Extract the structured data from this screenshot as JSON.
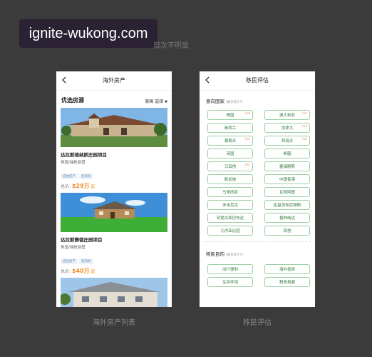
{
  "watermark": "ignite-wukong.com",
  "heading_text": "层次不明显",
  "left_screen": {
    "nav_title": "海外房产",
    "section_title": "优选房源",
    "filter_label": "美国 选择",
    "caret": "▼",
    "listings": [
      {
        "title": "达拉斯维纳斯庄园项目",
        "sub": "美国/独栋别墅",
        "tags": [
          "自住房产",
          "投资房"
        ],
        "price_label": "总价:",
        "price": "$29万",
        "price_unit": "起"
      },
      {
        "title": "达拉斯赛德庄园项目",
        "sub": "美国/独栋别墅",
        "tags": [
          "自住房产",
          "投资房"
        ],
        "price_label": "总价:",
        "price": "$40万",
        "price_unit": "起"
      }
    ],
    "caption": "海外房产列表"
  },
  "right_screen": {
    "nav_title": "移民评估",
    "section1_title": "意向国家",
    "section1_note": "(最多选3个)",
    "hot_label": "Hot",
    "countries": [
      {
        "name": "美国",
        "hot": true
      },
      {
        "name": "澳大利亚",
        "hot": true
      },
      {
        "name": "新西兰",
        "hot": false
      },
      {
        "name": "加拿大",
        "hot": true
      },
      {
        "name": "葡萄牙",
        "hot": true
      },
      {
        "name": "西班牙",
        "hot": true
      },
      {
        "name": "英国",
        "hot": false
      },
      {
        "name": "希腊",
        "hot": false
      },
      {
        "name": "马耳他",
        "hot": true
      },
      {
        "name": "塞浦路斯",
        "hot": false
      },
      {
        "name": "新加坡",
        "hot": false
      },
      {
        "name": "中国香港",
        "hot": false
      },
      {
        "name": "马来西亚",
        "hot": false
      },
      {
        "name": "瓦努阿图",
        "hot": false
      },
      {
        "name": "多米尼克",
        "hot": false
      },
      {
        "name": "圣基茨和尼维斯",
        "hot": false
      },
      {
        "name": "安提瓜和巴布达",
        "hot": false
      },
      {
        "name": "格林纳达",
        "hot": false
      },
      {
        "name": "几内亚比绍",
        "hot": false
      },
      {
        "name": "其他",
        "hot": false
      }
    ],
    "section2_title": "移民目的",
    "section2_note": "(最多选3个)",
    "purposes": [
      "出行便利",
      "海外投资",
      "生存环境",
      "税务规避"
    ],
    "caption": "移民评估"
  },
  "colors": {
    "background": "#3b3b3b",
    "accent_orange": "#f08a24",
    "chip_green": "#2f7a3c",
    "chip_border": "#9ccfa3"
  }
}
